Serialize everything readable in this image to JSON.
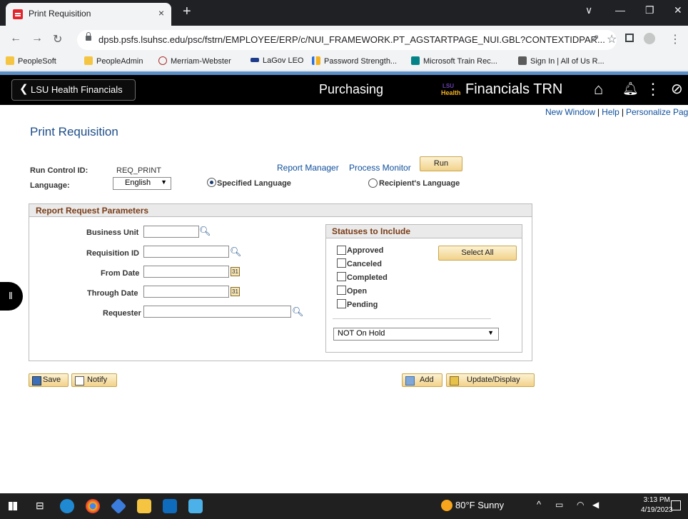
{
  "browser": {
    "tab_title": "Print Requisition",
    "tab_close": "×",
    "new_tab": "+",
    "url": "dpsb.psfs.lsuhsc.edu/psc/fstrn/EMPLOYEE/ERP/c/NUI_FRAMEWORK.PT_AGSTARTPAGE_NUI.GBL?CONTEXTIDPAR...",
    "window_buttons": [
      "∨",
      "—",
      "❐",
      "✕"
    ],
    "bookmarks": [
      {
        "label": "PeopleSoft",
        "icon": "folder-icon",
        "color": "#f5c542"
      },
      {
        "label": "PeopleAdmin",
        "icon": "folder-icon",
        "color": "#f5c542"
      },
      {
        "label": "Merriam-Webster",
        "icon": "mw-icon",
        "color": "#ffffff"
      },
      {
        "label": "LaGov LEO",
        "icon": "lagov-icon",
        "color": "#1e3a8a"
      },
      {
        "label": "Password Strength...",
        "icon": "password-icon",
        "color": "#2a6fdb"
      },
      {
        "label": "Microsoft Train Rec...",
        "icon": "sharepoint-icon",
        "color": "#038387"
      },
      {
        "label": "Sign In | All of Us R...",
        "icon": "allofus-icon",
        "color": "#5b5b5b"
      }
    ]
  },
  "header": {
    "back_label": "LSU Health Financials",
    "center_title": "Purchasing",
    "logo_top": "LSU",
    "logo_bottom": "Health",
    "app_title": "Financials TRN"
  },
  "page": {
    "links": [
      "New Window",
      "Help",
      "Personalize Page"
    ],
    "link_sep": "|",
    "title": "Print Requisition",
    "run_control_label": "Run Control ID:",
    "run_control_value": "REQ_PRINT",
    "report_manager": "Report Manager",
    "process_monitor": "Process Monitor",
    "run_button": "Run",
    "language_label": "Language:",
    "language_value": "English",
    "specified_language": "Specified Language",
    "recipients_language": "Recipient's Language"
  },
  "params": {
    "header": "Report Request Parameters",
    "business_unit": "Business Unit",
    "requisition_id": "Requisition ID",
    "from_date": "From Date",
    "through_date": "Through Date",
    "requester": "Requester",
    "calendar_glyph": "31",
    "statuses_header": "Statuses to Include",
    "statuses": [
      "Approved",
      "Canceled",
      "Completed",
      "Open",
      "Pending"
    ],
    "select_all": "Select All",
    "hold_value": "NOT On Hold"
  },
  "actions": {
    "save": "Save",
    "notify": "Notify",
    "add": "Add",
    "update_display": "Update/Display"
  },
  "taskbar": {
    "weather": "80°F  Sunny",
    "time": "3:13 PM",
    "date": "4/19/2023"
  },
  "colors": {
    "header_bg": "#000000",
    "link": "#0e4f9c",
    "section_title": "#7a3c17",
    "button": "#f2d28a"
  }
}
